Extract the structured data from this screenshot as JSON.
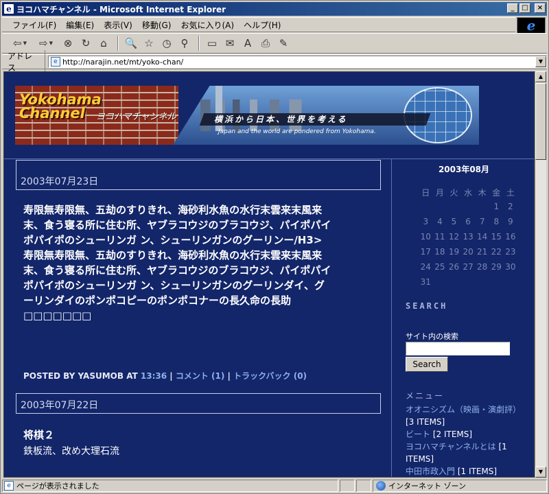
{
  "window": {
    "title": "ヨコハマチャンネル - Microsoft Internet Explorer",
    "app_icon_glyph": "e"
  },
  "window_buttons": {
    "minimize": "_",
    "maximize": "□",
    "close": "×"
  },
  "menubar": [
    "ファイル(F)",
    "編集(E)",
    "表示(V)",
    "移動(G)",
    "お気に入り(A)",
    "ヘルプ(H)"
  ],
  "toolbar": {
    "icons": [
      "back-icon",
      "forward-icon",
      "stop-icon",
      "refresh-icon",
      "home-icon",
      "search-icon",
      "favorites-icon",
      "history-icon",
      "channels-icon",
      "fullscreen-icon",
      "mail-icon",
      "font-icon",
      "print-icon",
      "edit-icon"
    ],
    "glyphs": {
      "back": "⇦",
      "forward": "⇨",
      "stop": "⊗",
      "refresh": "↻",
      "home": "⌂",
      "search": "🔍",
      "favorites": "☆",
      "history": "◷",
      "channels": "⚲",
      "fullscreen": "▭",
      "mail": "✉",
      "font": "A",
      "print": "⎙",
      "edit": "✎",
      "dropdown": "▼"
    }
  },
  "address": {
    "label": "アドレス",
    "url": "http://narajin.net/mt/yoko-chan/"
  },
  "banner": {
    "logo_line1": "Yokohama",
    "logo_line2": "Channel",
    "logo_kana": "ヨコハマチャンネル",
    "tagline_jp": "横浜から日本、世界を考える",
    "tagline_en": "Japan and the world are pondered from Yokohama."
  },
  "posts": [
    {
      "date": "2003年07月23日",
      "body": "寿限無寿限無、五劫のすりきれ、海砂利水魚の水行末雲来末風来末、食う寝る所に住む所、ヤブラコウジのブラコウジ、パイポパイポパイポのシューリンガ ン、シューリンガンのグーリンー/H3>寿限無寿限無、五劫のすりきれ、海砂利水魚の水行末雲来末風来末、食う寝る所に住む所、ヤブラコウジのブラコウジ、パイポパイポパイポのシューリンガ ン、シューリンガンのグーリンダイ、グーリンダイのポンポコピーのポンポコナーの長久命の長助□□□□□□□",
      "meta": {
        "prefix": "POSTED BY YASUMOB AT ",
        "time": "13:36",
        "sep": " | ",
        "comments": "コメント (1)",
        "trackbacks": "トラックバック (0)"
      }
    },
    {
      "date": "2003年07月22日",
      "title": "将棋２",
      "body": "鉄板流、改め大理石流"
    }
  ],
  "sidebar": {
    "calendar": {
      "title": "2003年08月",
      "weekdays": [
        "日",
        "月",
        "火",
        "水",
        "木",
        "金",
        "土"
      ],
      "days": [
        "",
        "",
        "",
        "",
        "",
        "1",
        "2",
        "3",
        "4",
        "5",
        "6",
        "7",
        "8",
        "9",
        "10",
        "11",
        "12",
        "13",
        "14",
        "15",
        "16",
        "17",
        "18",
        "19",
        "20",
        "21",
        "22",
        "23",
        "24",
        "25",
        "26",
        "27",
        "28",
        "29",
        "30",
        "31"
      ]
    },
    "search": {
      "title": "SEARCH",
      "label": "サイト内の検索",
      "button": "Search",
      "value": ""
    },
    "menu": {
      "title": "メニュー",
      "items": [
        {
          "name": "オオニシズム（映画・演劇評）",
          "count": "[3 ITEMS]"
        },
        {
          "name": "ビート",
          "count": "[2 ITEMS]"
        },
        {
          "name": "ヨコハマチャンネルとは",
          "count": "[1 ITEMS]"
        },
        {
          "name": "中田市政入門",
          "count": "[1 ITEMS]"
        }
      ]
    }
  },
  "scrollbar": {
    "up": "▲",
    "down": "▼"
  },
  "status": {
    "text": "ページが表示されました",
    "zone": "インターネット ゾーン"
  }
}
